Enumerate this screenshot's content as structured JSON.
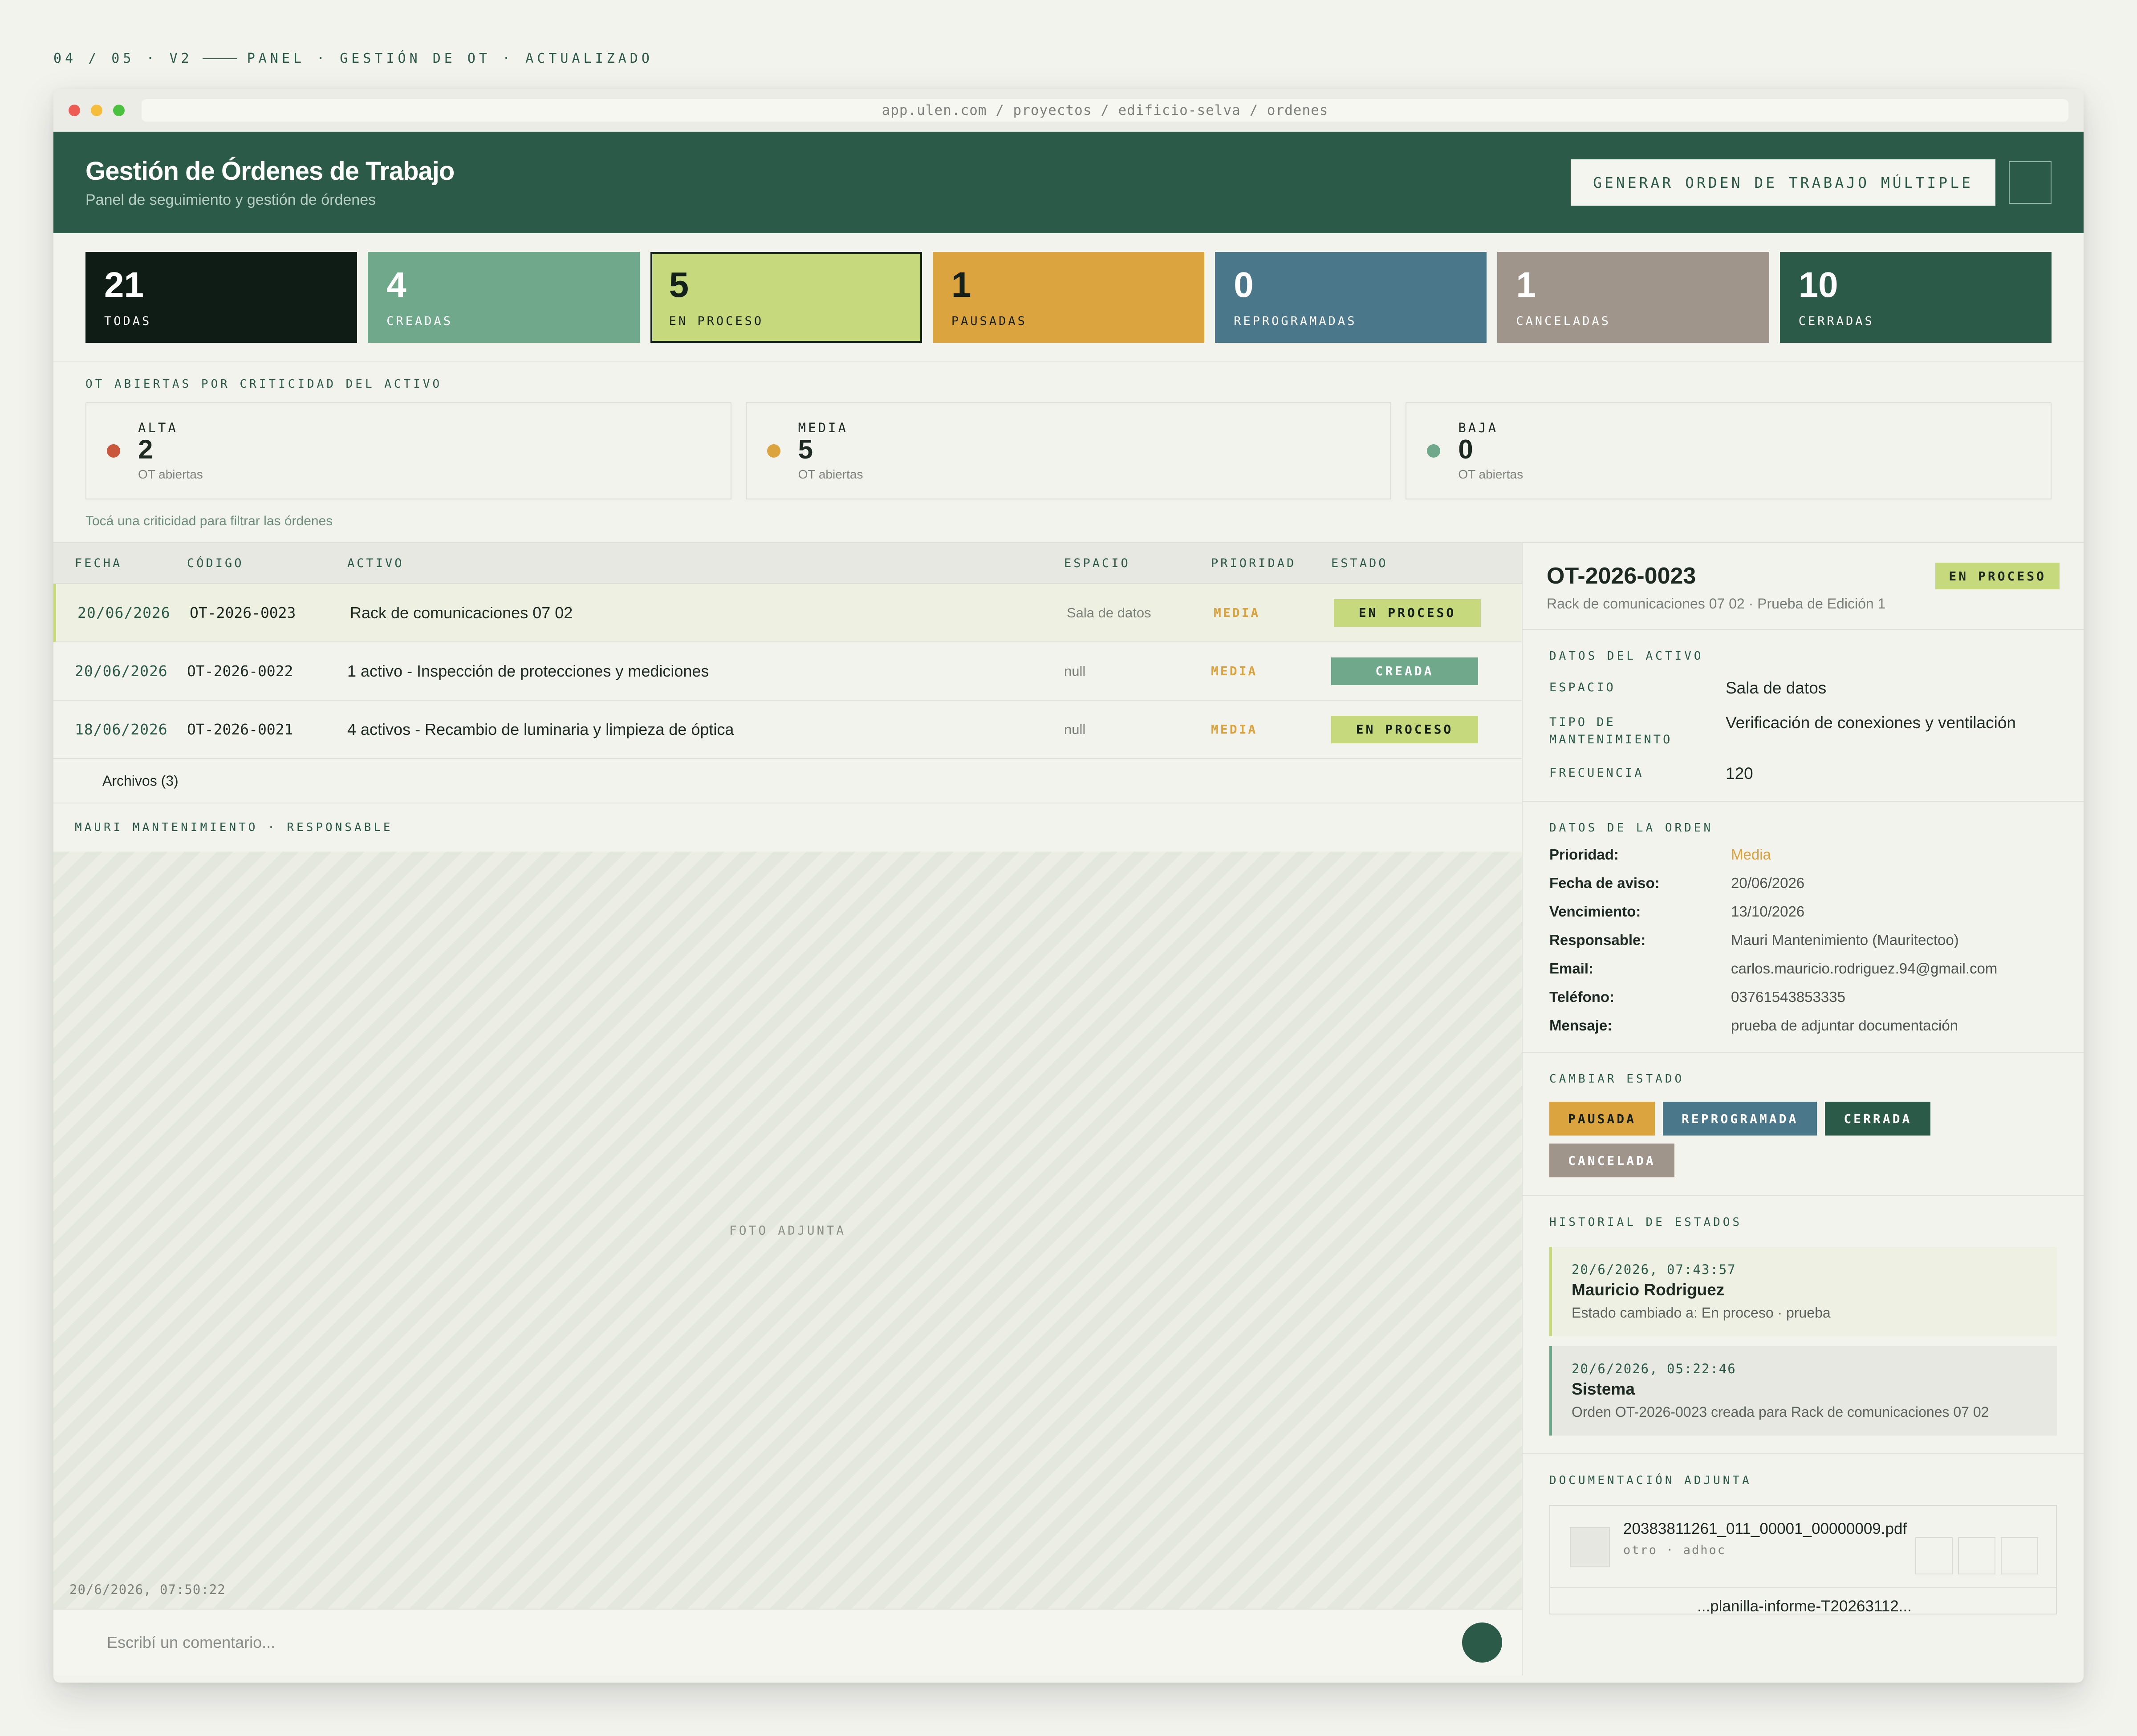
{
  "caption": {
    "left": "04 / 05 · V2",
    "right": "PANEL · GESTIÓN DE OT · ACTUALIZADO"
  },
  "browser": {
    "url": "app.ulen.com / proyectos / edificio-selva / ordenes"
  },
  "header": {
    "title": "Gestión de Órdenes de Trabajo",
    "subtitle": "Panel de seguimiento y gestión de órdenes",
    "generate_label": "GENERAR ORDEN DE TRABAJO MÚLTIPLE"
  },
  "status_cards": [
    {
      "count": "21",
      "label": "TODAS",
      "bg": "#0f1c15",
      "fg": "#ffffff"
    },
    {
      "count": "4",
      "label": "CREADAS",
      "bg": "#70a88b",
      "fg": "#ffffff"
    },
    {
      "count": "5",
      "label": "EN PROCESO",
      "bg": "#c6d97c",
      "fg": "#14201a"
    },
    {
      "count": "1",
      "label": "PAUSADAS",
      "bg": "#dca43e",
      "fg": "#14201a"
    },
    {
      "count": "0",
      "label": "REPROGRAMADAS",
      "bg": "#4a788a",
      "fg": "#ffffff"
    },
    {
      "count": "1",
      "label": "CANCELADAS",
      "bg": "#a0958a",
      "fg": "#ffffff"
    },
    {
      "count": "10",
      "label": "CERRADAS",
      "bg": "#2c5a48",
      "fg": "#ffffff"
    }
  ],
  "criticidad": {
    "title": "OT ABIERTAS POR CRITICIDAD DEL ACTIVO",
    "hint": "Tocá una criticidad para filtrar las órdenes",
    "items": [
      {
        "name": "ALTA",
        "count": "2",
        "sub": "OT abiertas",
        "color": "#c8573b"
      },
      {
        "name": "MEDIA",
        "count": "5",
        "sub": "OT abiertas",
        "color": "#dca43e"
      },
      {
        "name": "BAJA",
        "count": "0",
        "sub": "OT abiertas",
        "color": "#70a88b"
      }
    ]
  },
  "table": {
    "headers": [
      "FECHA",
      "CÓDIGO",
      "ACTIVO",
      "ESPACIO",
      "PRIORIDAD",
      "ESTADO"
    ],
    "rows": [
      {
        "fecha": "20/06/2026",
        "codigo": "OT-2026-0023",
        "activo": "Rack de comunicaciones 07 02",
        "espacio": "Sala de datos",
        "prioridad": "MEDIA",
        "estado": "EN PROCESO"
      },
      {
        "fecha": "20/06/2026",
        "codigo": "OT-2026-0022",
        "activo": "1 activo - Inspección de protecciones y mediciones",
        "espacio": "null",
        "prioridad": "MEDIA",
        "estado": "CREADA"
      },
      {
        "fecha": "18/06/2026",
        "codigo": "OT-2026-0021",
        "activo": "4 activos - Recambio de luminaria y limpieza de óptica",
        "espacio": "null",
        "prioridad": "MEDIA",
        "estado": "EN PROCESO"
      }
    ],
    "archivos": "Archivos (3)"
  },
  "photo": {
    "responsable": "MAURI MANTENIMIENTO · RESPONSABLE",
    "label": "FOTO ADJUNTA",
    "timestamp": "20/6/2026, 07:50:22"
  },
  "comment": {
    "placeholder": "Escribí un comentario..."
  },
  "detail": {
    "code": "OT-2026-0023",
    "status": "EN PROCESO",
    "subtitle": "Rack de comunicaciones 07 02 · Prueba de Edición 1",
    "activo_title": "DATOS DEL ACTIVO",
    "activo": [
      {
        "k": "ESPACIO",
        "v": "Sala de datos"
      },
      {
        "k": "TIPO DE MANTENIMIENTO",
        "v": "Verificación de conexiones y ventilación"
      },
      {
        "k": "FRECUENCIA",
        "v": "120"
      }
    ],
    "orden_title": "DATOS DE LA ORDEN",
    "orden": [
      {
        "k": "Prioridad:",
        "v": "Media"
      },
      {
        "k": "Fecha de aviso:",
        "v": "20/06/2026"
      },
      {
        "k": "Vencimiento:",
        "v": "13/10/2026"
      },
      {
        "k": "Responsable:",
        "v": "Mauri Mantenimiento (Mauritectoo)"
      },
      {
        "k": "Email:",
        "v": "carlos.mauricio.rodriguez.94@gmail.com"
      },
      {
        "k": "Teléfono:",
        "v": "03761543853335"
      },
      {
        "k": "Mensaje:",
        "v": "prueba de adjuntar documentación"
      }
    ],
    "estado_title": "CAMBIAR ESTADO",
    "estado_buttons": [
      "PAUSADA",
      "REPROGRAMADA",
      "CERRADA",
      "CANCELADA"
    ],
    "historial_title": "HISTORIAL DE ESTADOS",
    "historial": [
      {
        "ts": "20/6/2026, 07:43:57",
        "who": "Mauricio Rodriguez",
        "msg": "Estado cambiado a: En proceso · prueba"
      },
      {
        "ts": "20/6/2026, 05:22:46",
        "who": "Sistema",
        "msg": "Orden OT-2026-0023 creada para Rack de comunicaciones 07 02"
      }
    ],
    "docs_title": "DOCUMENTACIÓN ADJUNTA",
    "docs": [
      {
        "name": "20383811261_011_00001_00000009.pdf",
        "meta": "otro · adhoc"
      },
      {
        "name": "...planilla-informe-T20263112...",
        "meta": ""
      }
    ]
  },
  "colors": {
    "brand": "#2c5a48",
    "en_proceso": "#c6d97c",
    "creada": "#70a88b",
    "pausada": "#dca43e",
    "reprogramada": "#4a788a",
    "cerrada": "#2c5a48",
    "cancelada": "#a0958a"
  }
}
